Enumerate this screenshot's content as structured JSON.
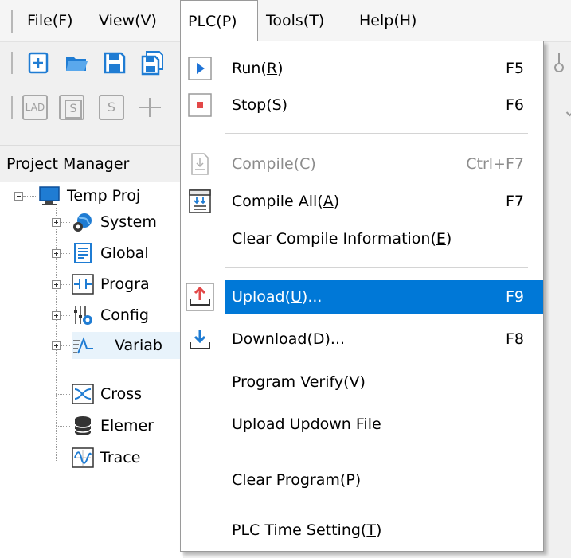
{
  "menubar": {
    "items": [
      {
        "label": "File(F)"
      },
      {
        "label": "View(V)"
      },
      {
        "label": "PLC(P)"
      },
      {
        "label": "Tools(T)"
      },
      {
        "label": "Help(H)"
      }
    ]
  },
  "project_manager": {
    "title": "Project Manager",
    "tree": [
      {
        "label": "Temp Proj",
        "icon": "computer-icon"
      },
      {
        "label": "System",
        "icon": "globe-gear-icon"
      },
      {
        "label": "Global",
        "icon": "document-list-icon"
      },
      {
        "label": "Progra",
        "icon": "ladder-icon"
      },
      {
        "label": "Config",
        "icon": "config-sliders-icon"
      },
      {
        "label": "Variab",
        "icon": "waveform-icon"
      },
      {
        "label": "Cross",
        "icon": "cross-reference-icon"
      },
      {
        "label": "Elemer",
        "icon": "database-icon"
      },
      {
        "label": "Trace",
        "icon": "trace-icon"
      }
    ]
  },
  "plc_menu": {
    "items": [
      {
        "pre": "Run(",
        "key": "R",
        "post": ")",
        "shortcut": "F5",
        "icon": "run-icon"
      },
      {
        "pre": "Stop(",
        "key": "S",
        "post": ")",
        "shortcut": "F6",
        "icon": "stop-icon"
      },
      {
        "pre": "Compile(",
        "key": "C",
        "post": ")",
        "shortcut": "Ctrl+F7",
        "icon": "compile-icon",
        "disabled": true
      },
      {
        "pre": "Compile All(",
        "key": "A",
        "post": ")",
        "shortcut": "F7",
        "icon": "compile-all-icon"
      },
      {
        "pre": "Clear Compile Information(",
        "key": "E",
        "post": ")",
        "shortcut": ""
      },
      {
        "pre": "Upload(",
        "key": "U",
        "post": ")...",
        "shortcut": "F9",
        "icon": "upload-icon",
        "highlighted": true
      },
      {
        "pre": "Download(",
        "key": "D",
        "post": ")...",
        "shortcut": "F8",
        "icon": "download-icon"
      },
      {
        "pre": "Program Verify(",
        "key": "V",
        "post": ")",
        "shortcut": ""
      },
      {
        "pre": "Upload Updown File",
        "key": "",
        "post": "",
        "shortcut": ""
      },
      {
        "pre": "Clear Program(",
        "key": "P",
        "post": ")",
        "shortcut": ""
      },
      {
        "pre": "PLC Time Setting(",
        "key": "T",
        "post": ")",
        "shortcut": ""
      }
    ]
  },
  "toolbar1": {
    "icons": [
      "new-file-icon",
      "open-folder-icon",
      "save-icon",
      "save-all-icon"
    ]
  },
  "toolbar2": {
    "labels": [
      "LAD",
      "S",
      "S"
    ],
    "icons": [
      "lad-button-icon",
      "sfc-button-icon",
      "st-button-icon",
      "contact-line-icon"
    ]
  },
  "colors": {
    "highlight": "#0078d7",
    "run_blue": "#1e73d6",
    "stop_red": "#e34848",
    "icon_blue": "#1f7cd3"
  }
}
